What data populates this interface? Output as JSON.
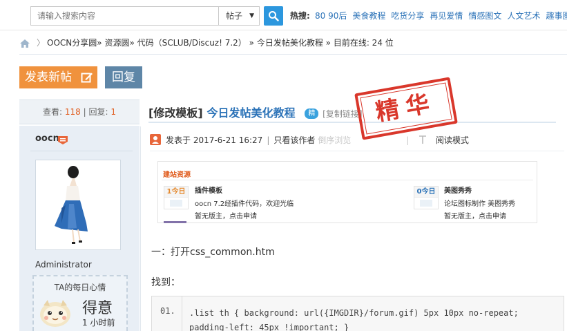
{
  "search": {
    "placeholder": "请输入搜索内容",
    "type": "帖子",
    "hot_label": "热搜:",
    "hot_items": [
      "80 90后",
      "美食教程",
      "吃货分享",
      "再见爱情",
      "情感图文",
      "人文艺术",
      "趣事图"
    ]
  },
  "breadcrumb": {
    "items": [
      "OOCN分享圆",
      "资源圆",
      "代码（SCLUB/Discuz! 7.2）",
      "今日发帖美化教程"
    ],
    "online_label": "目前在线: 24 位"
  },
  "actions": {
    "post_label": "发表新帖",
    "reply_label": "回复"
  },
  "stats": {
    "views_label": "查看:",
    "views": "118",
    "replies_label": "回复:",
    "replies": "1"
  },
  "thread": {
    "tag": "[修改模板]",
    "title": "今日发帖美化教程",
    "badge": "精",
    "copy_link": "[复制链接]",
    "stamp_text": "精华"
  },
  "author": {
    "name": "oocn",
    "group": "Administrator",
    "mood_title": "TA的每日心情",
    "mood": "得意",
    "mood_time": "1 小时前"
  },
  "post_meta": {
    "posted_at": "发表于 2017-6-21 16:27",
    "only_author": "只看该作者",
    "order_faded": "倒序浏览",
    "read_mode": "阅读模式"
  },
  "embed": {
    "section_title": "建站资源",
    "forums": [
      {
        "count": "1今日",
        "name": "插件模板",
        "desc": "oocn 7.2经插件代码，欢迎光临",
        "mod": "暂无版主，点击申请"
      },
      {
        "count": "0今日",
        "name": "美图秀秀",
        "desc": "论坛图标制作 美图秀秀",
        "mod": "暂无版主，点击申请"
      }
    ]
  },
  "content": {
    "step": "一：打开css_common.htm",
    "found": "找到："
  },
  "code": {
    "line_no": "01.",
    "text": ".list th { background: url({IMGDIR}/forum.gif) 5px 10px no-repeat; padding-left: 45px !important; }"
  },
  "colors": {
    "accent_blue": "#2c97de",
    "link_blue": "#2c73b8",
    "post_orange": "#f0923d",
    "reply_slate": "#5e86a7",
    "stamp_red": "#d9372b"
  }
}
